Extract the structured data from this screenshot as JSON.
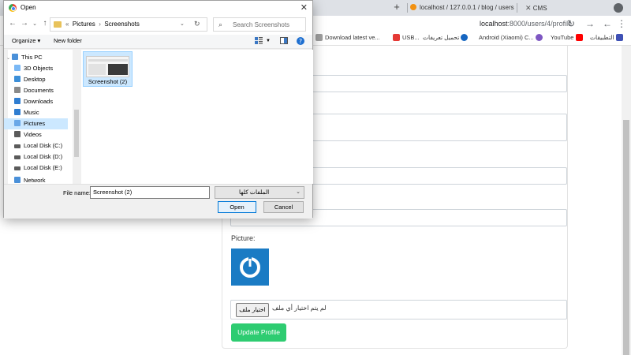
{
  "browser": {
    "tabs": [
      {
        "label": "localhost / 127.0.0.1 / blog / users"
      },
      {
        "label": "CMS"
      }
    ],
    "url_host": "localhost",
    "url_path": ":8000/users/4/profile",
    "bookmarks": [
      {
        "label": "Download latest ve...",
        "color": "#ffffff"
      },
      {
        "label": "USB...",
        "color": "#e53935"
      },
      {
        "label": "تحميل تعريفات",
        "color": "#1565c0"
      },
      {
        "label": "Android (Xiaomi) C...",
        "color": "#ffffff"
      },
      {
        "label": "YouTube",
        "color": "#ff0000"
      },
      {
        "label": "التطبيقات",
        "color": "#3f51b5"
      }
    ]
  },
  "page": {
    "picture_label": "Picture:",
    "file_input_button": "اختيار ملف",
    "file_input_status": "لم يتم اختيار أي ملف",
    "update_button": "Update Profile",
    "accent_color": "#2ecc71"
  },
  "dialog": {
    "title": "Open",
    "breadcrumb": [
      "«",
      "Pictures",
      "›",
      "Screenshots"
    ],
    "search_placeholder": "Search Screenshots",
    "organize_label": "Organize ▾",
    "new_folder_label": "New folder",
    "nav_items": [
      {
        "label": "This PC",
        "icon": "pc-icon",
        "color": "#4a90d9"
      },
      {
        "label": "3D Objects",
        "icon": "3d-objects-icon",
        "color": "#7ab8f5"
      },
      {
        "label": "Desktop",
        "icon": "desktop-icon",
        "color": "#3c8fd8"
      },
      {
        "label": "Documents",
        "icon": "documents-icon",
        "color": "#8a8a8a"
      },
      {
        "label": "Downloads",
        "icon": "downloads-icon",
        "color": "#2f7dd1"
      },
      {
        "label": "Music",
        "icon": "music-icon",
        "color": "#2f7dd1"
      },
      {
        "label": "Pictures",
        "icon": "pictures-icon",
        "color": "#6aa8e8"
      },
      {
        "label": "Videos",
        "icon": "videos-icon",
        "color": "#5b5b5b"
      },
      {
        "label": "Local Disk (C:)",
        "icon": "disk-icon",
        "color": "#5b5b5b"
      },
      {
        "label": "Local Disk (D:)",
        "icon": "disk-icon",
        "color": "#5b5b5b"
      },
      {
        "label": "Local Disk (E:)",
        "icon": "disk-icon",
        "color": "#5b5b5b"
      },
      {
        "label": "Network",
        "icon": "network-icon",
        "color": "#4a90d9"
      }
    ],
    "selected_nav": "Pictures",
    "file_item": "Screenshot (2)",
    "file_name_label": "File name:",
    "file_name_value": "Screenshot (2)",
    "file_type_filter": "الملفات كلها",
    "open_button": "Open",
    "cancel_button": "Cancel"
  }
}
